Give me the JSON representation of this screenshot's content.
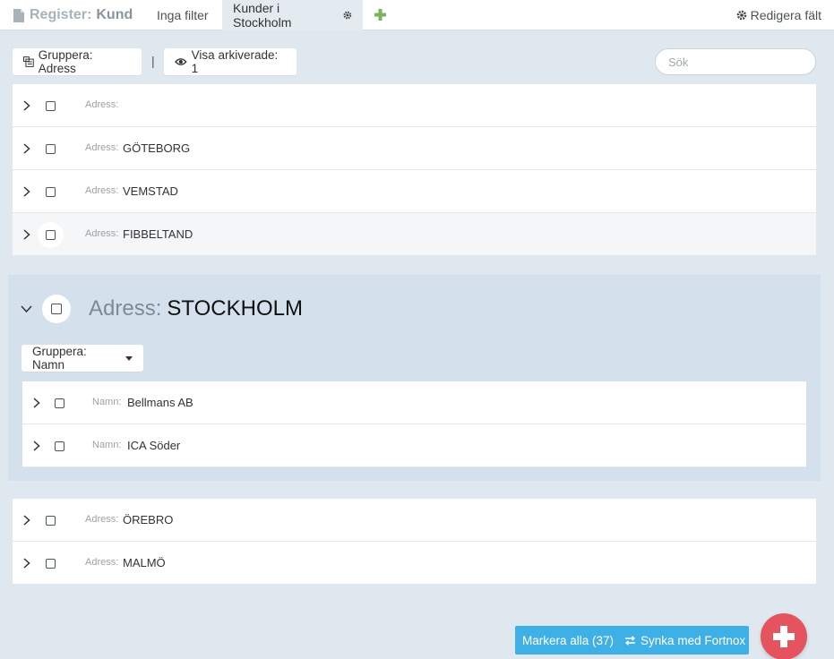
{
  "topbar": {
    "register_prefix": "Register:",
    "register_entity": "Kund",
    "tabs": [
      {
        "label": "Inga filter"
      },
      {
        "label": "Kunder i Stockholm"
      }
    ],
    "edit_fields_label": "Redigera fält"
  },
  "toolbar": {
    "group_label": "Gruppera: Adress",
    "separator": "|",
    "archived_label": "Visa arkiverade: 1",
    "search_placeholder": "Sök"
  },
  "rows_top": [
    {
      "label": "Adress:",
      "value": ""
    },
    {
      "label": "Adress:",
      "value": "GÖTEBORG"
    },
    {
      "label": "Adress:",
      "value": "VEMSTAD"
    },
    {
      "label": "Adress:",
      "value": "FIBBELTAND"
    }
  ],
  "expanded_group": {
    "key": "Adress:",
    "value": "STOCKHOLM",
    "group_by_label": "Gruppera: Namn",
    "rows": [
      {
        "label": "Namn:",
        "value": "Bellmans AB"
      },
      {
        "label": "Namn:",
        "value": "ICA Söder"
      }
    ]
  },
  "rows_bottom": [
    {
      "label": "Adress:",
      "value": "ÖREBRO"
    },
    {
      "label": "Adress:",
      "value": "MALMÖ"
    }
  ],
  "actions": {
    "mark_all_label": "Markera alla (37)",
    "sync_label": "Synka med Fortnox"
  },
  "colors": {
    "accent_green": "#7ab55c",
    "action_blue": "#3fb0e6",
    "fab_red": "#e5535f",
    "group_bg": "#d4e1ec",
    "page_bg": "#dfe8ee"
  }
}
